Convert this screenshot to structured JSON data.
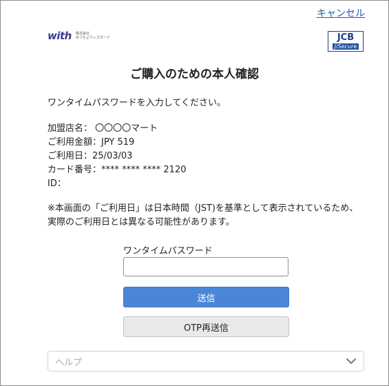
{
  "header": {
    "cancel_label": "キャンセル",
    "with_logo_text": "with",
    "with_logo_sub_line1": "株式会社",
    "with_logo_sub_line2": "ゆうちょウィズカード",
    "jcb_logo_top": "JCB",
    "jcb_logo_bottom": "J/Secure"
  },
  "main": {
    "title": "ご購入のための本人確認",
    "instruction": "ワンタイムパスワードを入力してください。",
    "details": {
      "merchant_label": "加盟店名：",
      "merchant_value": "〇〇〇〇マート",
      "amount_label": "ご利用金額：",
      "amount_value": "JPY 519",
      "date_label": "ご利用日：",
      "date_value": "25/03/03",
      "card_label": "カード番号：",
      "card_value": "**** **** **** 2120",
      "id_label": "ID：",
      "id_value": ""
    },
    "notice_line1": "※本画面の「ご利用日」は日本時間（JST)を基準として表示されているため、",
    "notice_line2": "実際のご利用日とは異なる可能性があります。"
  },
  "form": {
    "otp_label": "ワンタイムパスワード",
    "otp_value": "",
    "otp_placeholder": "",
    "send_label": "送信",
    "resend_label": "OTP再送信"
  },
  "help": {
    "label": "ヘルプ",
    "icon": "chevron-down-icon"
  },
  "colors": {
    "link": "#1a5fb4",
    "primary_button": "#4a86d8",
    "secondary_button": "#e9e9e9",
    "jcb_blue": "#1c3c8c"
  }
}
